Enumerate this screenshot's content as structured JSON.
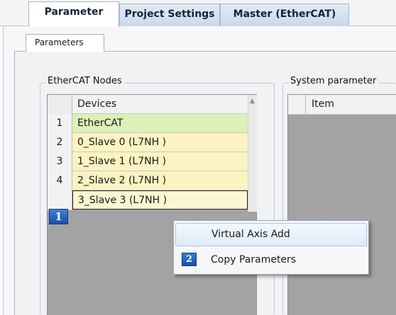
{
  "tabs": [
    {
      "label": "Parameter",
      "active": true
    },
    {
      "label": "Project Settings",
      "active": false
    },
    {
      "label": "Master (EtherCAT)",
      "active": false
    }
  ],
  "subtab": {
    "label": "Parameters"
  },
  "ethercat_nodes": {
    "title": "EtherCAT Nodes",
    "column_header": "Devices",
    "rows": [
      {
        "num": "1",
        "device": "EtherCAT",
        "color": "#dcf0b8"
      },
      {
        "num": "2",
        "device": "0_Slave 0 (L7NH )",
        "color": "#fbf3c2"
      },
      {
        "num": "3",
        "device": "1_Slave 1 (L7NH )",
        "color": "#fbf3c2"
      },
      {
        "num": "4",
        "device": "2_Slave 2 (L7NH )",
        "color": "#fbf3c2"
      },
      {
        "num": "",
        "device": "3_Slave 3 (L7NH )",
        "color": "#fdf6d2"
      }
    ]
  },
  "system_parameter": {
    "title": "System parameter",
    "column_header": "Item"
  },
  "badges": {
    "step1": "1",
    "step2": "2"
  },
  "context_menu": {
    "items": [
      {
        "label": "Virtual Axis Add",
        "highlighted": true
      },
      {
        "label": "Copy Parameters",
        "highlighted": false
      }
    ]
  }
}
